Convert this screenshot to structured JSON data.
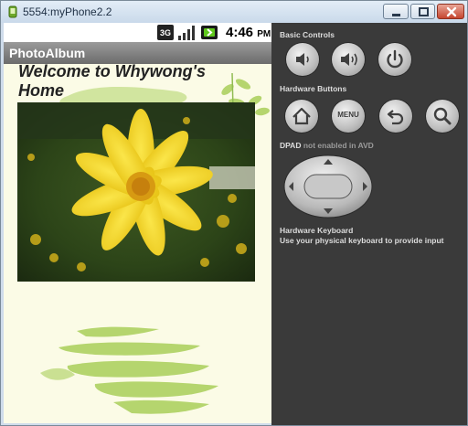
{
  "window": {
    "title": "5554:myPhone2.2",
    "controls": [
      "minimize",
      "maximize",
      "close"
    ]
  },
  "device": {
    "status_bar": {
      "time": "4:46",
      "ampm": "PM",
      "icons": [
        "3g-icon",
        "signal-icon",
        "battery-icon"
      ]
    },
    "app_title": "PhotoAlbum",
    "content": {
      "welcome_text": "Welcome to Whywong's Home",
      "photo": "yellow-cosmos-flower-photo"
    }
  },
  "controls_panel": {
    "basic_controls_label": "Basic Controls",
    "basic_buttons": [
      "volume-down-icon",
      "volume-up-icon",
      "power-icon"
    ],
    "hardware_buttons_label": "Hardware Buttons",
    "hardware_buttons": [
      "home-icon",
      "menu",
      "back-icon",
      "search-icon"
    ],
    "menu_label": "MENU",
    "dpad_label_main": "DPAD",
    "dpad_label_note": " not enabled in AVD",
    "keyboard_title": "Hardware Keyboard",
    "keyboard_hint": "Use your physical keyboard to provide input"
  },
  "colors": {
    "panel_bg": "#3a3a3a",
    "app_bg": "#fbfbe6",
    "app_bar": "#7a7a7a",
    "leaf_green": "#a9cf5a",
    "flower_yellow": "#f2d21b"
  }
}
